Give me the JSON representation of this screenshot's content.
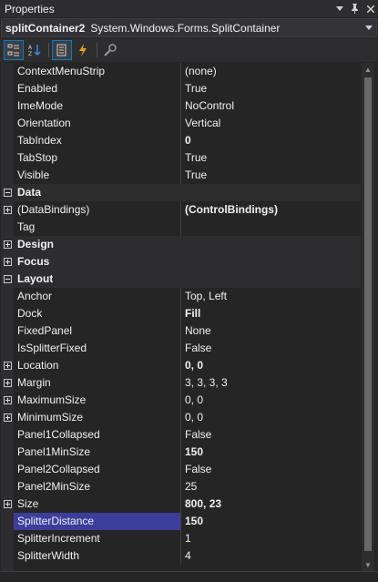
{
  "window": {
    "title": "Properties"
  },
  "selector": {
    "object_name": "splitContainer2",
    "object_type": "System.Windows.Forms.SplitContainer"
  },
  "toolbar": {
    "buttons": [
      {
        "name": "categorized-icon"
      },
      {
        "name": "alphabetical-icon"
      },
      {
        "name": "properties-icon"
      },
      {
        "name": "events-icon"
      },
      {
        "name": "property-pages-icon"
      }
    ]
  },
  "grid": {
    "rows": [
      {
        "kind": "prop",
        "name": "ContextMenuStrip",
        "value": "(none)"
      },
      {
        "kind": "prop",
        "name": "Enabled",
        "value": "True"
      },
      {
        "kind": "prop",
        "name": "ImeMode",
        "value": "NoControl"
      },
      {
        "kind": "prop",
        "name": "Orientation",
        "value": "Vertical"
      },
      {
        "kind": "prop",
        "name": "TabIndex",
        "value": "0",
        "bold": true
      },
      {
        "kind": "prop",
        "name": "TabStop",
        "value": "True"
      },
      {
        "kind": "prop",
        "name": "Visible",
        "value": "True"
      },
      {
        "kind": "cat",
        "name": "Data",
        "expanded": true
      },
      {
        "kind": "prop",
        "name": "(DataBindings)",
        "value": "(ControlBindings)",
        "bold": true,
        "expander": "plus"
      },
      {
        "kind": "prop",
        "name": "Tag",
        "value": ""
      },
      {
        "kind": "cat",
        "name": "Design",
        "expanded": false
      },
      {
        "kind": "cat",
        "name": "Focus",
        "expanded": false
      },
      {
        "kind": "cat",
        "name": "Layout",
        "expanded": true
      },
      {
        "kind": "prop",
        "name": "Anchor",
        "value": "Top, Left"
      },
      {
        "kind": "prop",
        "name": "Dock",
        "value": "Fill",
        "bold": true
      },
      {
        "kind": "prop",
        "name": "FixedPanel",
        "value": "None"
      },
      {
        "kind": "prop",
        "name": "IsSplitterFixed",
        "value": "False"
      },
      {
        "kind": "prop",
        "name": "Location",
        "value": "0, 0",
        "bold": true,
        "expander": "plus"
      },
      {
        "kind": "prop",
        "name": "Margin",
        "value": "3, 3, 3, 3",
        "expander": "plus"
      },
      {
        "kind": "prop",
        "name": "MaximumSize",
        "value": "0, 0",
        "expander": "plus"
      },
      {
        "kind": "prop",
        "name": "MinimumSize",
        "value": "0, 0",
        "expander": "plus"
      },
      {
        "kind": "prop",
        "name": "Panel1Collapsed",
        "value": "False"
      },
      {
        "kind": "prop",
        "name": "Panel1MinSize",
        "value": "150",
        "bold": true
      },
      {
        "kind": "prop",
        "name": "Panel2Collapsed",
        "value": "False"
      },
      {
        "kind": "prop",
        "name": "Panel2MinSize",
        "value": "25"
      },
      {
        "kind": "prop",
        "name": "Size",
        "value": "800, 23",
        "bold": true,
        "expander": "plus"
      },
      {
        "kind": "prop",
        "name": "SplitterDistance",
        "value": "150",
        "bold": true,
        "selected": true
      },
      {
        "kind": "prop",
        "name": "SplitterIncrement",
        "value": "1"
      },
      {
        "kind": "prop",
        "name": "SplitterWidth",
        "value": "4"
      }
    ]
  },
  "colors": {
    "selection": "#3d3d9c",
    "accent": "#007acc",
    "background": "#252526"
  }
}
